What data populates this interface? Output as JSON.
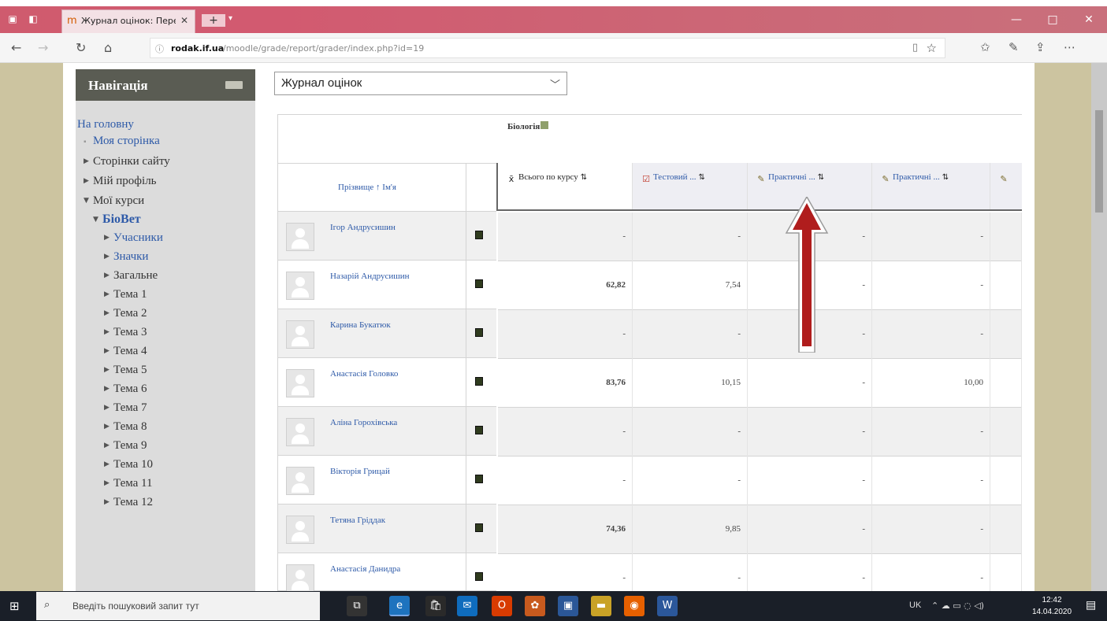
{
  "browser": {
    "tab_title": "Журнал оцінок: Перегл",
    "tab_close": "✕",
    "new_tab": "+",
    "url_host": "rodak.if.ua",
    "url_path": "/moodle/grade/report/grader/index.php?id=19",
    "window_controls": [
      "—",
      "□",
      "✕"
    ]
  },
  "navigation": {
    "title": "Навігація",
    "home": "На головну",
    "my_page": "Моя сторінка",
    "site_pages": "Сторінки сайту",
    "my_profile": "Мій профіль",
    "my_courses": "Мої курси",
    "course": "БіоВет",
    "participants": "Учасники",
    "badges": "Значки",
    "general": "Загальне",
    "topics": [
      "Тема 1",
      "Тема 2",
      "Тема 3",
      "Тема 4",
      "Тема 5",
      "Тема 6",
      "Тема 7",
      "Тема 8",
      "Тема 9",
      "Тема 10",
      "Тема 11",
      "Тема 12"
    ]
  },
  "report_select": {
    "value": "Журнал оцінок"
  },
  "grader": {
    "course_name": "Біологія",
    "name_header": "Прізвище ↑ Ім'я",
    "columns": [
      {
        "icon": "x̄",
        "label": "Всього по курсу"
      },
      {
        "icon": "☑",
        "label": "Тестовий ..."
      },
      {
        "icon": "✎",
        "label": "Практичні ..."
      },
      {
        "icon": "✎",
        "label": "Практичні ..."
      },
      {
        "icon": "✎",
        "label": ""
      }
    ],
    "sort_glyph": "⇅",
    "students": [
      {
        "name": "Ігор Андрусишин",
        "grades": [
          "-",
          "-",
          "-",
          "-"
        ]
      },
      {
        "name": "Назарій Андрусишин",
        "grades": [
          "62,82",
          "7,54",
          "-",
          "-"
        ]
      },
      {
        "name": "Карина Букатюк",
        "grades": [
          "-",
          "-",
          "-",
          "-"
        ]
      },
      {
        "name": "Анастасія Головко",
        "grades": [
          "83,76",
          "10,15",
          "-",
          "10,00"
        ]
      },
      {
        "name": "Аліна Горохівська",
        "grades": [
          "-",
          "-",
          "-",
          "-"
        ]
      },
      {
        "name": "Вікторія Грицай",
        "grades": [
          "-",
          "-",
          "-",
          "-"
        ]
      },
      {
        "name": "Тетяна Гріддак",
        "grades": [
          "74,36",
          "9,85",
          "-",
          "-"
        ]
      },
      {
        "name": "Анастасія Данидра",
        "grades": [
          "-",
          "-",
          "-",
          "-"
        ]
      }
    ]
  },
  "taskbar": {
    "search_placeholder": "Введіть пошуковий запит тут",
    "lang": "UK",
    "time": "12:42",
    "date": "14.04.2020"
  },
  "colors": {
    "tabbar": "#cf5b6e",
    "nav_header": "#5a5c53",
    "link": "#2e5aa8",
    "arrow": "#b01d1d",
    "page_bg": "#ccc4a0"
  }
}
